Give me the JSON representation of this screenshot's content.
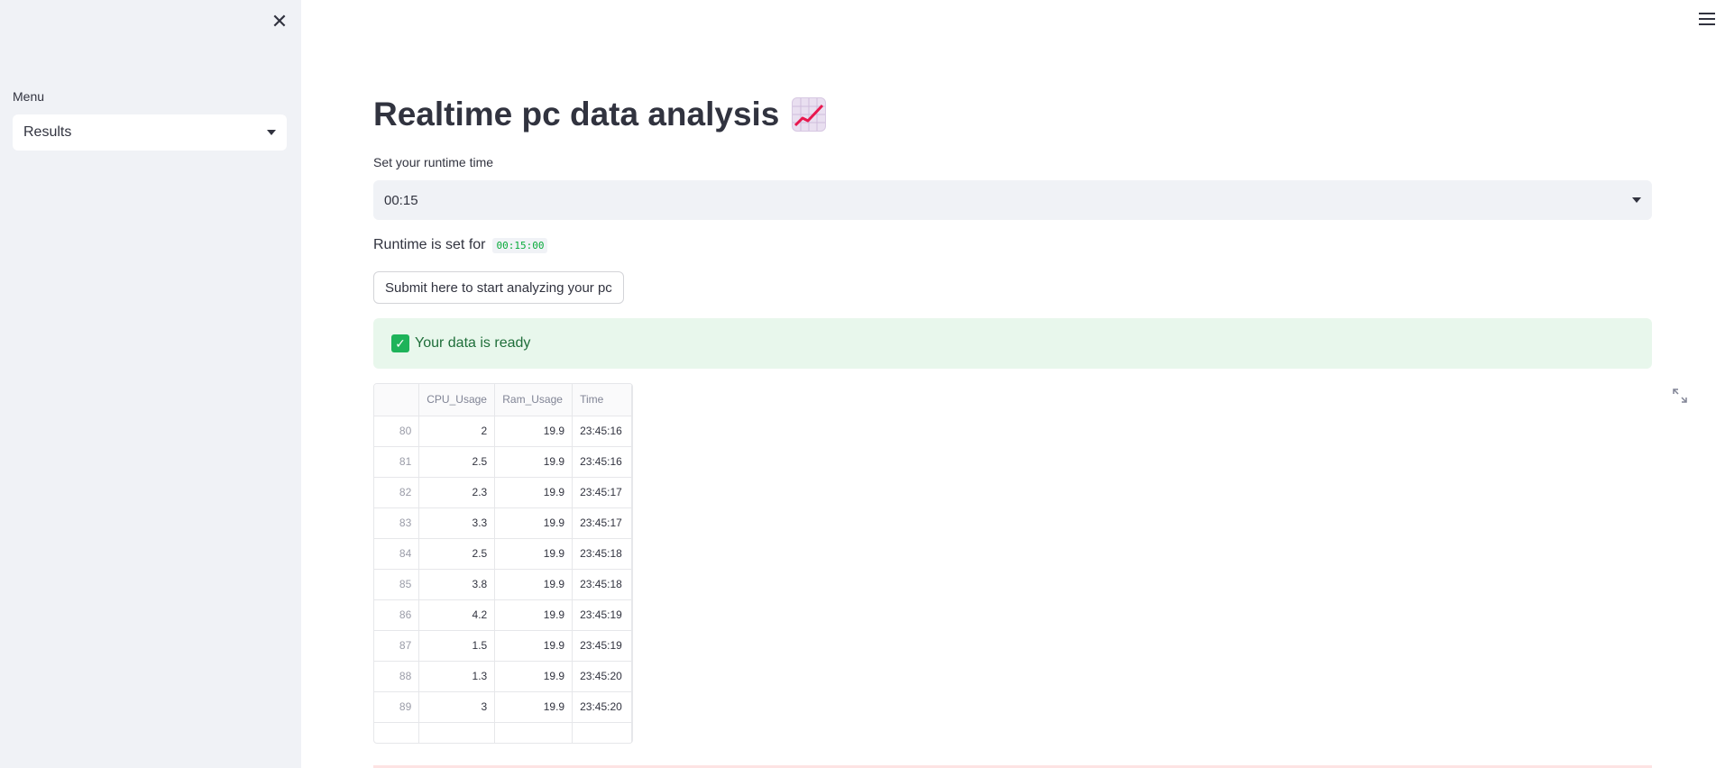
{
  "sidebar": {
    "close_icon": "close-icon",
    "menu_label": "Menu",
    "menu_selected": "Results"
  },
  "header": {
    "menu_icon": "hamburger-icon"
  },
  "main": {
    "title": "Realtime pc data analysis",
    "title_icon": "chart-increasing-emoji",
    "runtime_label": "Set your runtime time",
    "runtime_selected": "00:15",
    "runtime_info_prefix": "Runtime is set for",
    "runtime_info_value": "00:15:00",
    "submit_label": "Submit here to start analyzing your pc",
    "success_message": "Your data is ready",
    "accent_success": "#1eb35a"
  },
  "table": {
    "columns": [
      "",
      "CPU_Usage",
      "Ram_Usage",
      "Time"
    ],
    "rows": [
      [
        "80",
        "2",
        "19.9",
        "23:45:16"
      ],
      [
        "81",
        "2.5",
        "19.9",
        "23:45:16"
      ],
      [
        "82",
        "2.3",
        "19.9",
        "23:45:17"
      ],
      [
        "83",
        "3.3",
        "19.9",
        "23:45:17"
      ],
      [
        "84",
        "2.5",
        "19.9",
        "23:45:18"
      ],
      [
        "85",
        "3.8",
        "19.9",
        "23:45:18"
      ],
      [
        "86",
        "4.2",
        "19.9",
        "23:45:19"
      ],
      [
        "87",
        "1.5",
        "19.9",
        "23:45:19"
      ],
      [
        "88",
        "1.3",
        "19.9",
        "23:45:20"
      ],
      [
        "89",
        "3",
        "19.9",
        "23:45:20"
      ]
    ]
  }
}
